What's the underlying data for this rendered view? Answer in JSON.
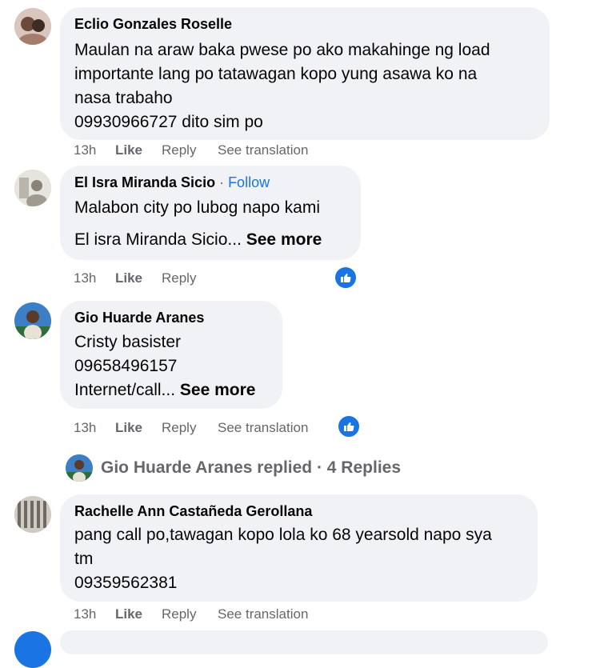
{
  "comments": [
    {
      "author": "Eclio Gonzales Roselle",
      "lines": [
        "Maulan na araw baka pwese po ako makahinge ng load",
        "importante lang po tatawagan kopo yung asawa ko na",
        "nasa trabaho",
        "09930966727 dito sim po"
      ],
      "time": "13h",
      "like": "Like",
      "reply": "Reply",
      "translate": "See translation"
    },
    {
      "author": "El Isra Miranda Sicio",
      "separator": " · ",
      "follow": "Follow",
      "lines": [
        "Malabon city po lubog napo kami"
      ],
      "truncated_text": "El isra Miranda Sicio...",
      "see_more": "See more",
      "time": "13h",
      "like": "Like",
      "reply": "Reply",
      "reaction_icon": "like-reaction-icon"
    },
    {
      "author": "Gio Huarde Aranes",
      "lines": [
        "Cristy basister",
        "09658496157"
      ],
      "truncated_text": "Internet/call...",
      "see_more": "See more",
      "time": "13h",
      "like": "Like",
      "reply": "Reply",
      "translate": "See translation",
      "reaction_icon": "like-reaction-icon"
    },
    {
      "author": "Rachelle Ann Castañeda Gerollana",
      "lines": [
        "pang call po,tawagan kopo lola ko 68 yearsold napo sya",
        "tm",
        "09359562381"
      ],
      "time": "13h",
      "like": "Like",
      "reply": "Reply",
      "translate": "See translation"
    }
  ],
  "replies_summary": {
    "text": "Gio Huarde Aranes replied · 4 Replies"
  },
  "colors": {
    "bubble": "#f0f2f5",
    "link_blue": "#1b74e4",
    "meta_gray": "#65676b"
  }
}
